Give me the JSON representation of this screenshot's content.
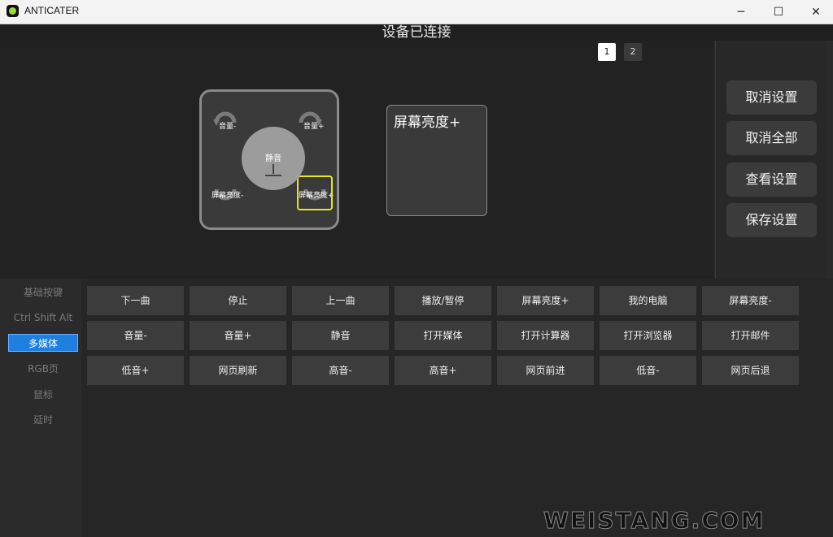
{
  "window": {
    "title": "ANTICATER",
    "minimize": "─",
    "maximize": "☐",
    "close": "✕"
  },
  "status": "设备已连接",
  "pages": [
    "1",
    "2"
  ],
  "device": {
    "knob_label": "静音",
    "keys": {
      "top_left": "音量-",
      "top_right": "音量+",
      "bottom_left": "屏幕亮度-",
      "bottom_right": "屏幕亮度+"
    }
  },
  "preview": {
    "label": "屏幕亮度+"
  },
  "actions": [
    "取消设置",
    "取消全部",
    "查看设置",
    "保存设置"
  ],
  "sidebar": {
    "items": [
      "基础按键",
      "Ctrl Shift Alt",
      "多媒体",
      "RGB页",
      "鼠标",
      "延时"
    ],
    "active_index": 2
  },
  "function_keys": {
    "rows": [
      [
        "下一曲",
        "停止",
        "上一曲",
        "播放/暂停",
        "屏幕亮度+",
        "我的电脑",
        "屏幕亮度-"
      ],
      [
        "音量-",
        "音量+",
        "静音",
        "打开媒体",
        "打开计算器",
        "打开浏览器",
        "打开邮件"
      ],
      [
        "低音+",
        "网页刷新",
        "高音-",
        "高音+",
        "网页前进",
        "低音-",
        "网页后退"
      ]
    ]
  },
  "watermark": "WEISTANG.COM",
  "colors": {
    "accent": "#1e7fe0",
    "selection": "#e6e61c",
    "button_bg": "#3c3c3c"
  }
}
